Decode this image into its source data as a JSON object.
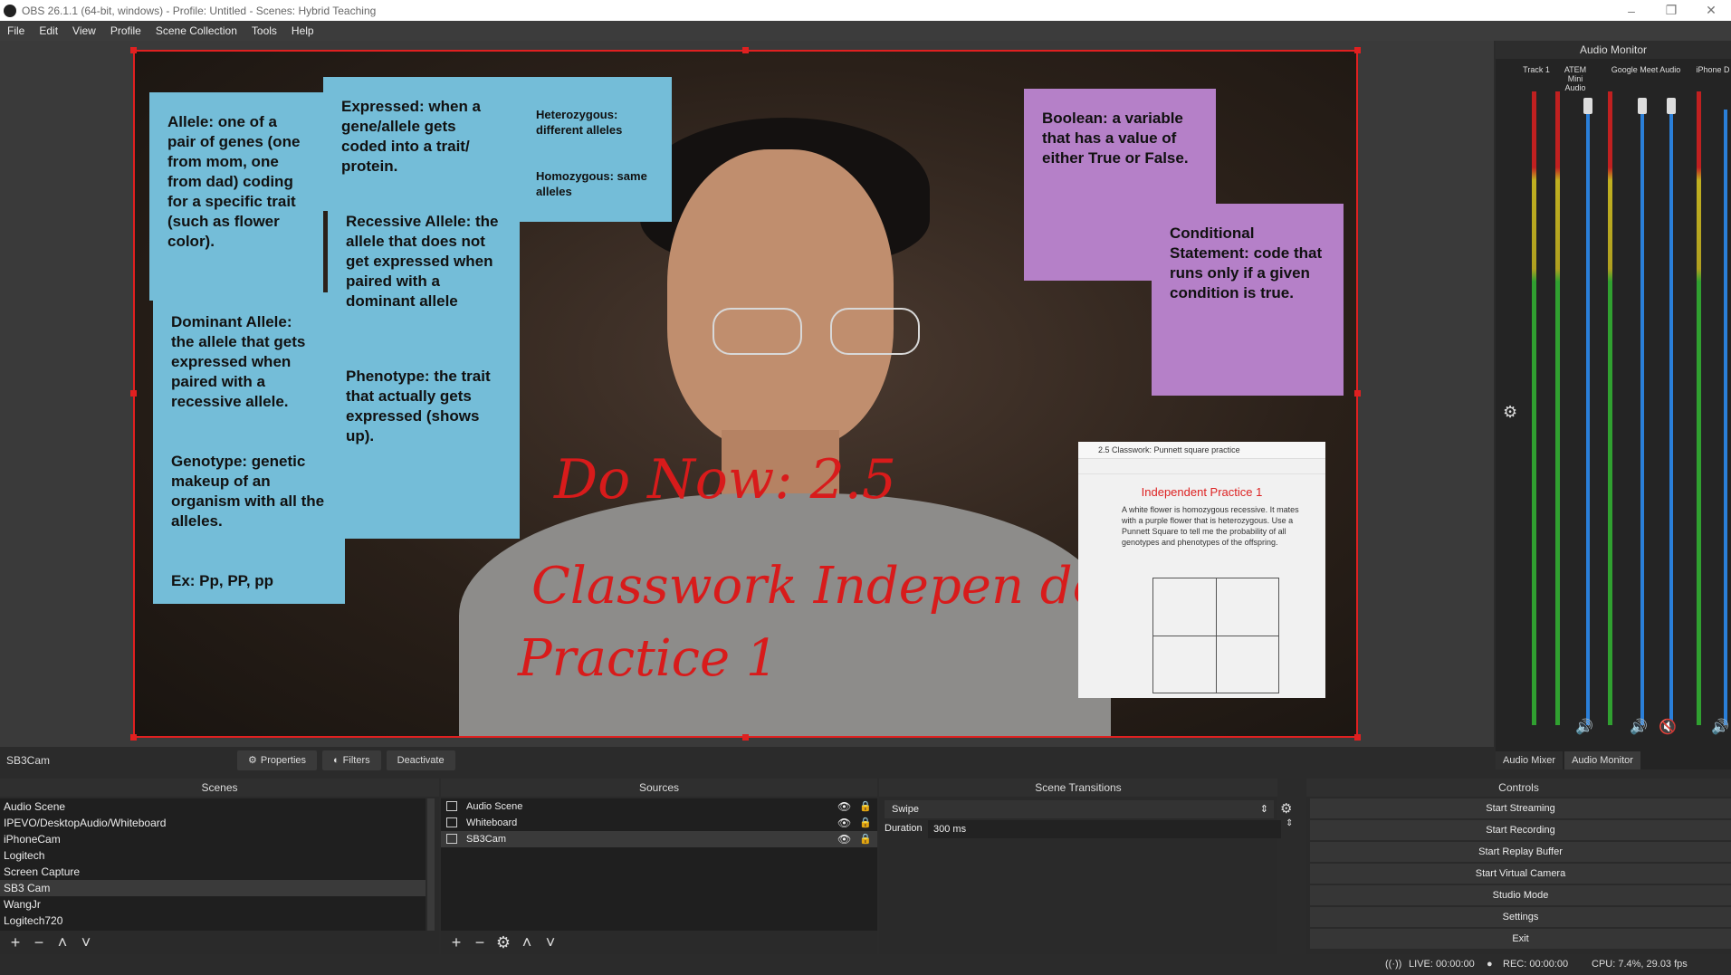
{
  "window": {
    "title": "OBS 26.1.1 (64-bit, windows) - Profile: Untitled - Scenes: Hybrid Teaching"
  },
  "menu": [
    "File",
    "Edit",
    "View",
    "Profile",
    "Scene Collection",
    "Tools",
    "Help"
  ],
  "preview": {
    "notes": {
      "allele": "Allele: one of a pair of genes (one from mom, one from dad) coding for a specific trait (such as flower color).",
      "dominant": "Dominant Allele: the allele that gets expressed when paired with a recessive allele.",
      "genotype": "Genotype: genetic makeup of an organism with all the alleles.",
      "genotype_ex": "Ex: Pp, PP, pp",
      "expressed": "Expressed: when a gene/allele gets coded into a trait/ protein.",
      "recessive": "Recessive Allele: the allele that does not get expressed when paired with a dominant allele",
      "phenotype": "Phenotype: the trait that actually gets expressed (shows up).",
      "hetero": "Heterozygous: different alleles",
      "homo": "Homozygous: same alleles",
      "boolean": "Boolean: a variable that has a value of either True or False.",
      "conditional": "Conditional Statement: code that runs only if a given condition is true."
    },
    "handwriting": {
      "line1": "Do Now: 2.5",
      "line2": "Classwork Indepen dent",
      "line3": "Practice 1"
    },
    "screen_capture": {
      "window_title": "2.5 Classwork: Punnett square practice",
      "heading": "Independent Practice 1",
      "body": "A white flower is homozygous recessive. It mates with a purple flower that is heterozygous. Use a Punnett Square to tell me the probability of all genotypes and phenotypes of the offspring."
    }
  },
  "audio_monitor": {
    "title": "Audio Monitor",
    "channels": [
      "Track 1",
      "ATEM Mini Audio",
      "Google Meet Audio",
      "iPhone D"
    ],
    "tabs": [
      "Audio Mixer",
      "Audio Monitor"
    ]
  },
  "source_bar": {
    "selected": "SB3Cam",
    "properties": "Properties",
    "filters": "Filters",
    "deactivate": "Deactivate"
  },
  "scenes": {
    "title": "Scenes",
    "items": [
      "Audio Scene",
      "IPEVO/DesktopAudio/Whiteboard",
      "iPhoneCam",
      "Logitech",
      "Screen Capture",
      "SB3 Cam",
      "WangJr",
      "Logitech720"
    ],
    "selected_index": 5
  },
  "sources": {
    "title": "Sources",
    "items": [
      "Audio Scene",
      "Whiteboard",
      "SB3Cam"
    ],
    "selected_index": 2
  },
  "transitions": {
    "title": "Scene Transitions",
    "type": "Swipe",
    "duration_label": "Duration",
    "duration_value": "300 ms"
  },
  "controls": {
    "title": "Controls",
    "buttons": [
      "Start Streaming",
      "Start Recording",
      "Start Replay Buffer",
      "Start Virtual Camera",
      "Studio Mode",
      "Settings",
      "Exit"
    ]
  },
  "status": {
    "live": "LIVE: 00:00:00",
    "rec": "REC: 00:00:00",
    "cpu": "CPU: 7.4%, 29.03 fps"
  }
}
